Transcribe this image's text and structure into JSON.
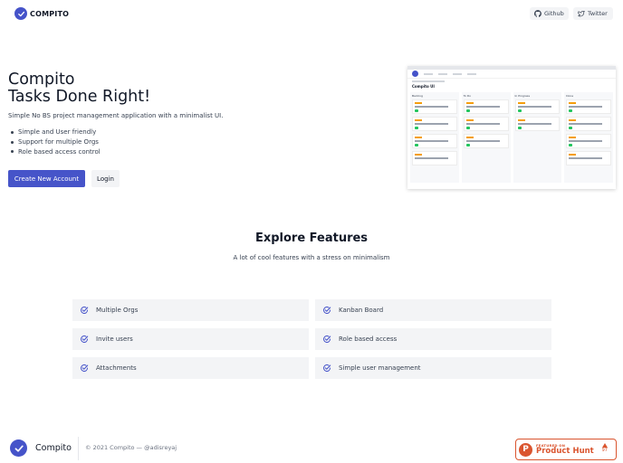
{
  "header": {
    "brand": "COMPITO",
    "github_label": "Github",
    "twitter_label": "Twitter"
  },
  "hero": {
    "title_line1": "Compito",
    "title_line2": "Tasks Done Right!",
    "subtitle": "Simple No BS project management application with a minimalist UI.",
    "bullets": [
      "Simple and User friendly",
      "Support for multiple Orgs",
      "Role based access control"
    ],
    "primary_cta": "Create New Account",
    "secondary_cta": "Login"
  },
  "preview": {
    "board_title": "Compito UI",
    "columns": [
      "Backlog",
      "To Do",
      "In Progress",
      "Done"
    ]
  },
  "features": {
    "title": "Explore Features",
    "subtitle": "A lot of cool features with a stress on minimalism",
    "items": [
      "Multiple Orgs",
      "Kanban Board",
      "Invite users",
      "Role based access",
      "Attachments",
      "Simple user management"
    ]
  },
  "footer": {
    "name": "Compito",
    "copyright": "© 2021 Compito —  @adisreyaj"
  },
  "product_hunt": {
    "featured": "FEATURED ON",
    "name": "Product Hunt",
    "votes": "97"
  },
  "colors": {
    "brand": "#4553c9",
    "product_hunt": "#da552f"
  }
}
